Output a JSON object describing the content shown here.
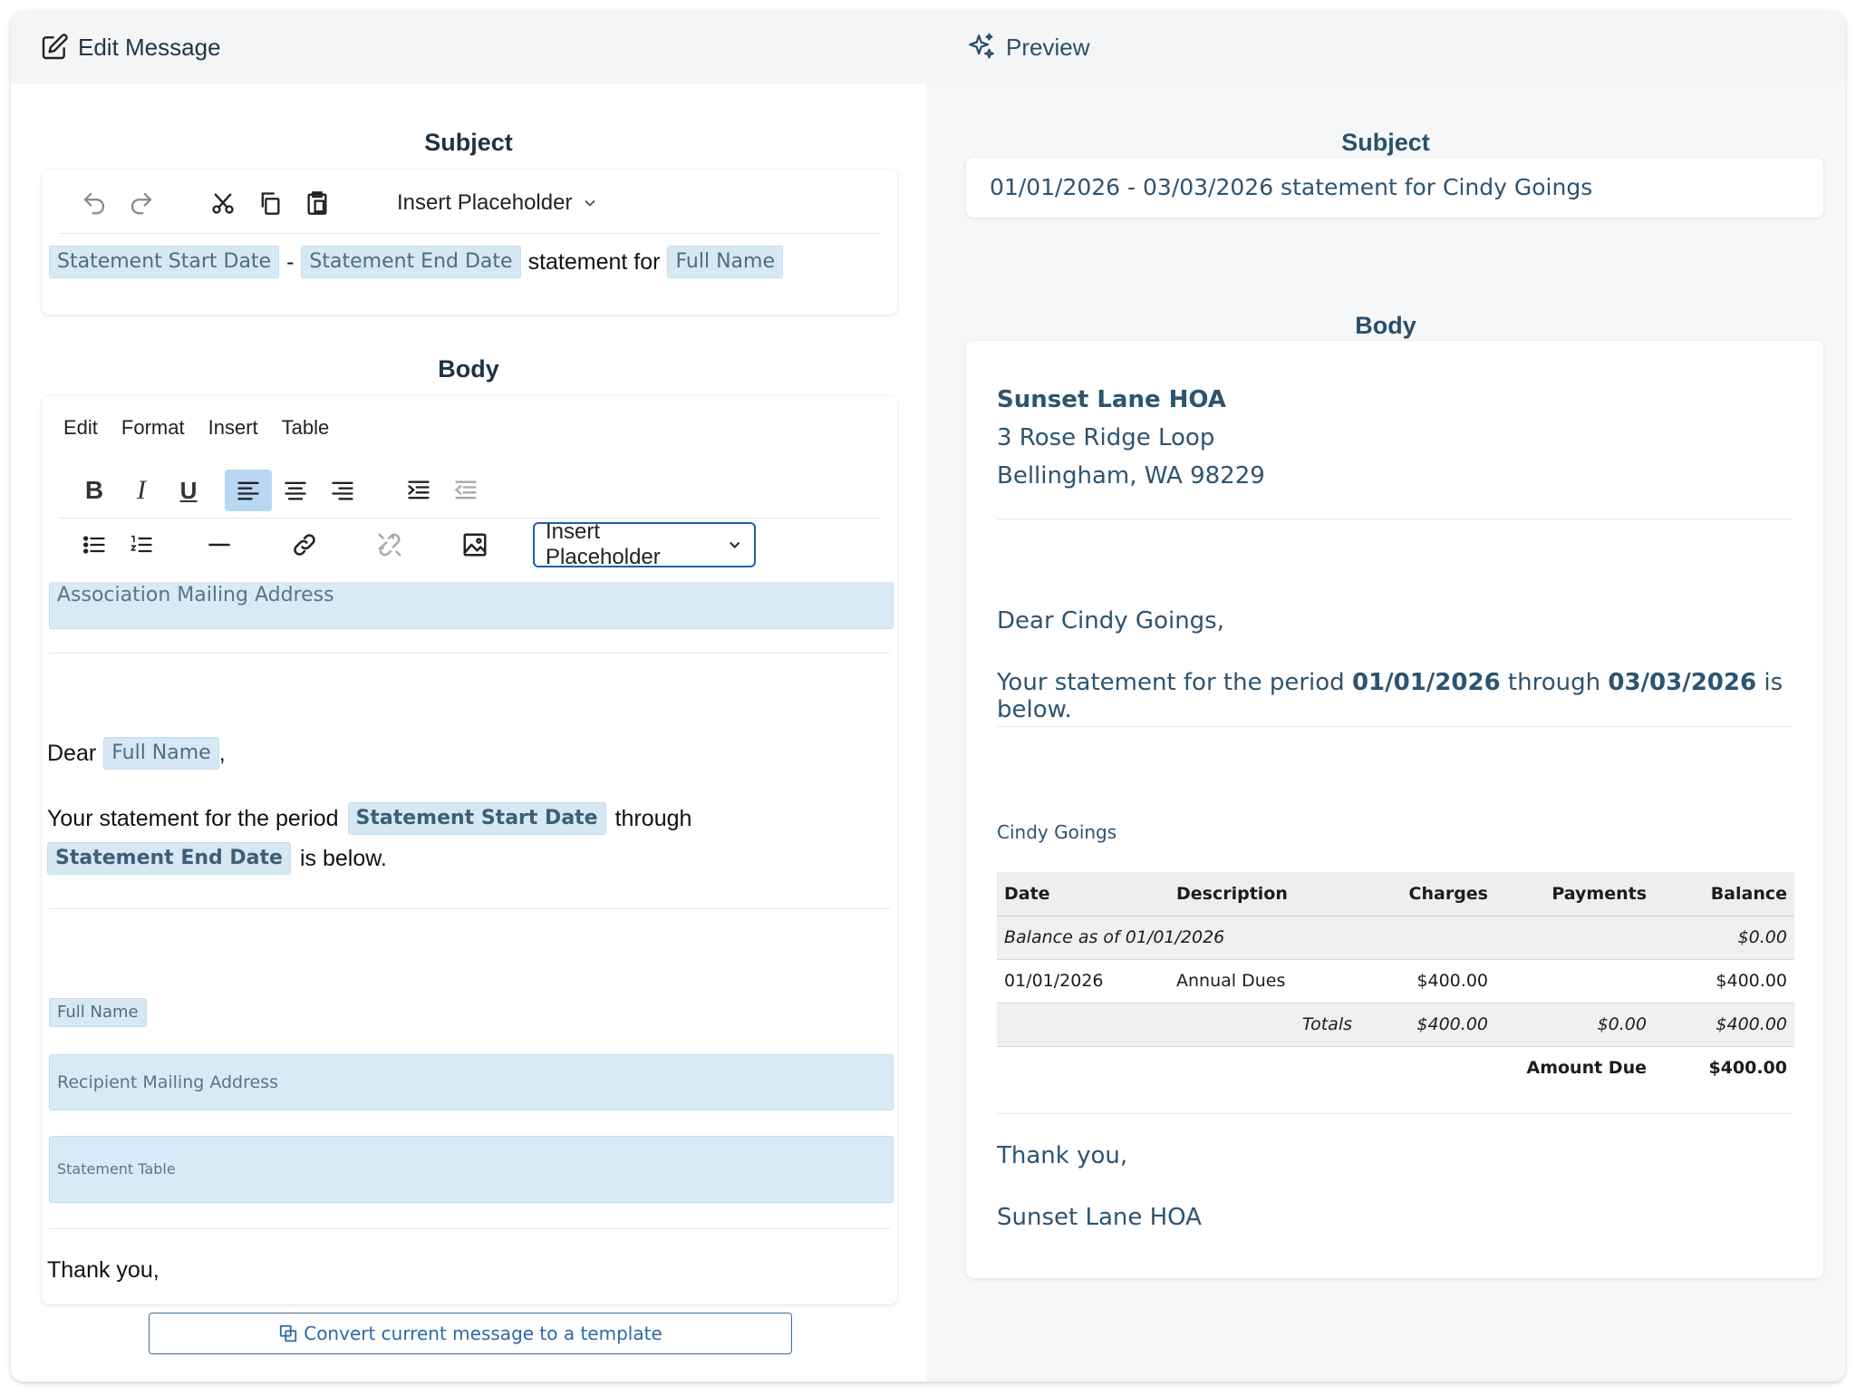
{
  "edit_panel": {
    "title": "Edit Message",
    "subject_label": "Subject",
    "body_label": "Body",
    "subject_toolbar": {
      "placeholder_dropdown": "Insert Placeholder"
    },
    "subject_content": {
      "chip1": "Statement Start Date",
      "sep": "-",
      "chip2": "Statement End Date",
      "text": "statement for",
      "chip3": "Full Name"
    },
    "body_menu": [
      "Edit",
      "Format",
      "Insert",
      "Table"
    ],
    "body_toolbar": {
      "placeholder_dropdown": "Insert Placeholder"
    },
    "body_content": {
      "assoc_address": "Association Mailing Address",
      "dear": "Dear",
      "dear_chip": "Full Name",
      "dear_comma": ",",
      "period_text": "Your statement for the period",
      "start_chip": "Statement Start Date",
      "through": "through",
      "end_chip": "Statement End Date",
      "is_below": "is below.",
      "recipient_name": "Full Name",
      "recipient_address": "Recipient Mailing Address",
      "statement_table": "Statement Table",
      "thanks": "Thank you,"
    },
    "convert_button": "Convert current message to a template"
  },
  "preview_panel": {
    "title": "Preview",
    "subject_label": "Subject",
    "subject_value": "01/01/2026 - 03/03/2026 statement for Cindy Goings",
    "body_label": "Body",
    "assoc_name": "Sunset Lane HOA",
    "assoc_street": "3 Rose Ridge Loop",
    "assoc_city": "Bellingham, WA 98229",
    "greeting": "Dear Cindy Goings,",
    "period_prefix": "Your statement for the period",
    "start_date": "01/01/2026",
    "through": "through",
    "end_date": "03/03/2026",
    "period_suffix": "is below.",
    "recipient": "Cindy Goings",
    "table": {
      "headers": [
        "Date",
        "Description",
        "Charges",
        "Payments",
        "Balance"
      ],
      "balance_row": {
        "label": "Balance as of 01/01/2026",
        "balance": "$0.00"
      },
      "rows": [
        {
          "date": "01/01/2026",
          "description": "Annual Dues",
          "charges": "$400.00",
          "payments": "",
          "balance": "$400.00"
        }
      ],
      "totals": {
        "label": "Totals",
        "charges": "$400.00",
        "payments": "$0.00",
        "balance": "$400.00"
      },
      "amount_due": {
        "label": "Amount Due",
        "value": "$400.00"
      }
    },
    "thanks": "Thank you,",
    "signature": "Sunset Lane HOA"
  }
}
